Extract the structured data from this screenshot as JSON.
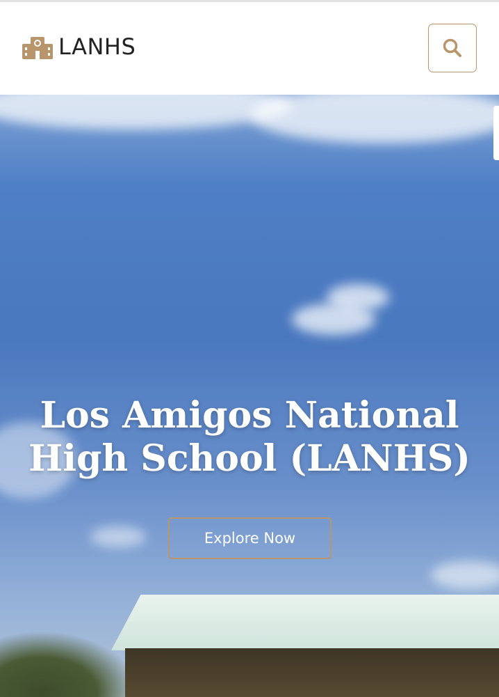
{
  "header": {
    "brand_text": "LANHS",
    "brand_icon": "school-building-icon",
    "search_icon": "search-icon"
  },
  "hero": {
    "title": "Los Amigos National High School (LANHS)",
    "button_label": "Explore Now"
  },
  "colors": {
    "accent": "#b8956a",
    "brand_text": "#222222",
    "header_bg": "#ffffff",
    "sky": "#4a78be"
  }
}
